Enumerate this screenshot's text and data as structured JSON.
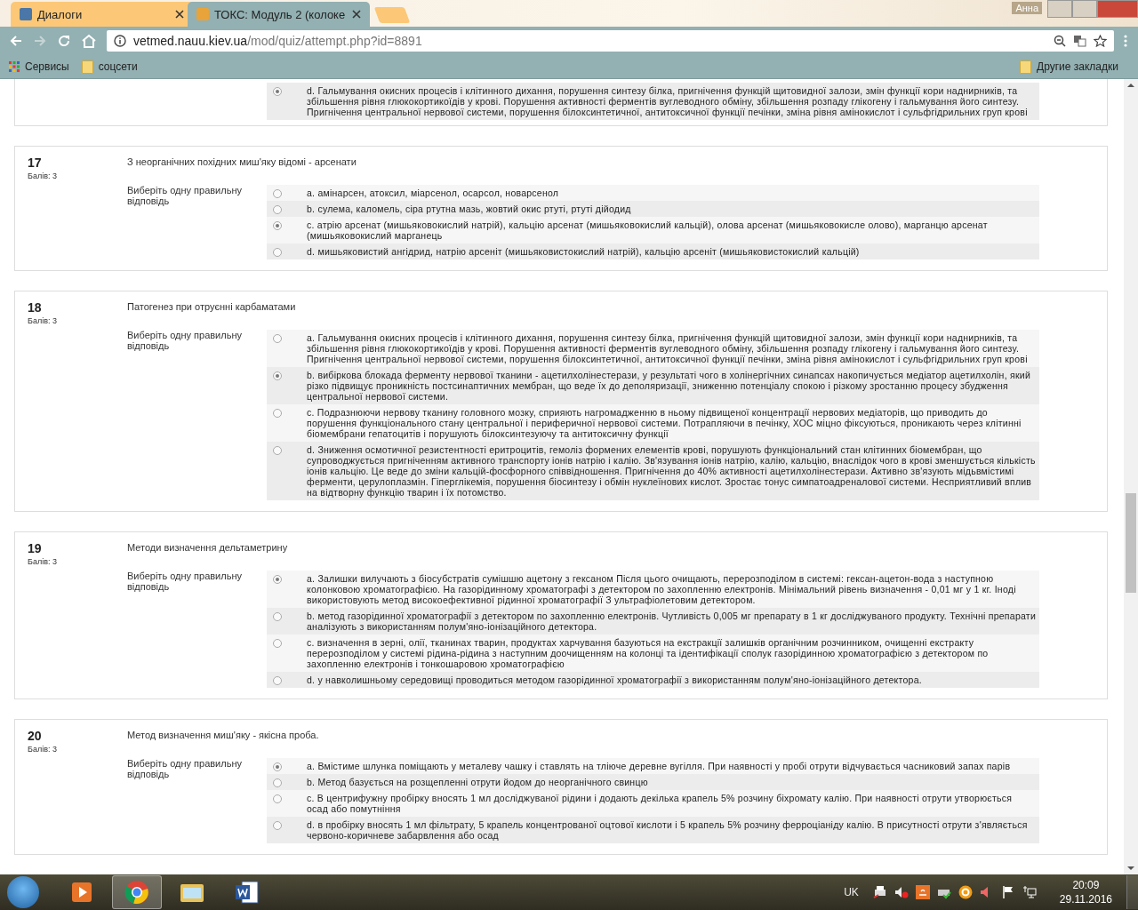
{
  "browser": {
    "tabs": [
      {
        "title": "Диалоги",
        "selected": false
      },
      {
        "title": "ТОКС: Модуль 2 (колоке",
        "selected": true
      }
    ],
    "profile": "Анна",
    "url_host": "vetmed.nauu.kiev.ua",
    "url_path": "/mod/quiz/attempt.php?id=8891",
    "bookmarks": [
      "Сервисы",
      "соцсети"
    ],
    "other_bookmarks": "Другие закладки"
  },
  "previous_question_tail": {
    "options": [
      {
        "letter": "d.",
        "text": "Гальмування окисних процесів і клітинного дихання, порушення синтезу білка, пригнічення функцій щитовидної залози, змін функції кори наднирників, та збільшення рівня глюкокортикоїдів у крові. Порушення активності ферментів вуглеводного обміну, збільшення розпаду глікогену і гальмування його синтезу. Пригнічення центральної нервової системи, порушення білоксинтетичної, антитоксичної функції печінки, зміна рівня амінокислот і сульфгідрильних груп крові",
        "selected": true
      }
    ]
  },
  "questions": [
    {
      "number": "17",
      "mark": "Балів: 3",
      "text": "З неорганічних похідних миш'яку відомі - арсенати",
      "prompt": "Виберіть одну правильну відповідь",
      "options": [
        {
          "letter": "a.",
          "text": "амінарсен, атоксил, міарсенол, осарсол, новарсенол",
          "selected": false
        },
        {
          "letter": "b.",
          "text": "сулема, каломель, сіра ртутна мазь, жовтий окис ртуті, ртуті дійодид",
          "selected": false
        },
        {
          "letter": "c.",
          "text": "атрію арсенат (мишьяковокислий натрій), кальцію арсенат (мишьяковокислий кальцій), олова арсенат (мишьяковокисле олово), марганцю арсенат (мишьяковокислий марганець",
          "selected": true
        },
        {
          "letter": "d.",
          "text": "мишьяковистий ангідрид, натрію арсеніт (мишьяковистокислий натрій), кальцію арсеніт (мишьяковистокислий кальцій)",
          "selected": false
        }
      ]
    },
    {
      "number": "18",
      "mark": "Балів: 3",
      "text": "Патогенез при отруєнні карбаматами",
      "prompt": "Виберіть одну правильну відповідь",
      "options": [
        {
          "letter": "a.",
          "text": "Гальмування окисних процесів і клітинного дихання, порушення синтезу білка, пригнічення функцій щитовидної залози, змін функції кори наднирників, та збільшення рівня глюкокортикоїдів у крові. Порушення активності ферментів вуглеводного обміну, збільшення розпаду глікогену і гальмування його синтезу. Пригнічення центральної нервової системи, порушення білоксинтетичної, антитоксичної функції печінки, зміна рівня амінокислот і сульфгідрильних груп крові",
          "selected": false
        },
        {
          "letter": "b.",
          "text": "вибіркова блокада ферменту нервової тканини - ацетилхолінестерази, у результаті чого в холінергічних синапсах накопичується медіатор ацетилхолін, який різко підвищує проникність постсинаптичних мембран, що веде їх до деполяризації, зниженню потенціалу спокою і різкому зростанню процесу збудження центральної нервової системи.",
          "selected": true
        },
        {
          "letter": "c.",
          "text": "Подразнюючи нервову тканину головного мозку, сприяють нагромадженню в ньому підвищеної концентрації нервових медіаторів, що приводить до порушення функціонального стану центральної і периферичної нервової системи. Потрапляючи в печінку, ХОС міцно фіксуються, проникають через клітинні біомембрани гепатоцитів і порушують білоксинтезуючу та антитоксичну функції",
          "selected": false
        },
        {
          "letter": "d.",
          "text": "Зниження осмотичної резистентності еритроцитів, гемоліз формених елементів крові, порушують функціональний стан клітинних біомембран, що супроводжується пригніченням активного транспорту іонів натрію і калію. Зв'язування іонів натрію, калію, кальцію, внаслідок чого в крові зменшується кількість іонів кальцію. Це веде до зміни кальцій-фосфорного співвідношення. Пригнічення до 40% активності ацетилхолінестерази. Активно зв'язують мідьвмістимі ферменти, церулоплазмін. Гіперглікемія, порушення біосинтезу і обмін нуклеїнових кислот. Зростає тонус симпатоадреналової системи. Несприятливий вплив на відтворну функцію тварин і їх потомство.",
          "selected": false
        }
      ]
    },
    {
      "number": "19",
      "mark": "Балів: 3",
      "text": "Методи визначення дельтаметрину",
      "prompt": "Виберіть одну правильну відповідь",
      "options": [
        {
          "letter": "a.",
          "text": "Залишки вилучають з біосубстратів сумішшю ацетону з гексаном Після цього очищають, перерозподілом в системі: гексан-ацетон-вода з наступною колонковою хроматографією. На газорідинному хроматографі з детектором по захопленню електронів. Мінімальний рівень визначення - 0,01 мг у 1 кг. Іноді використовують метод високоефективної рідинної хроматографії З ультрафіолетовим детектором.",
          "selected": true
        },
        {
          "letter": "b.",
          "text": "метод газорідинної хроматографії з детектором по захопленню електронів. Чутливість 0,005 мг препарату в 1 кг досліджуваного продукту. Технічні препарати аналізують з використанням полум'яно-іонізаційного детектора.",
          "selected": false
        },
        {
          "letter": "c.",
          "text": "визначення в зерні, олії, тканинах тварин, продуктах харчування базуються на екстракції залишків органічним розчинником, очищенні екстракту перерозподілом у системі рідина-рідина з наступним доочищенням на колонці та ідентифікації сполук газорідинною хроматографією з детектором по захопленню електронів і тонкошаровою хроматографією",
          "selected": false
        },
        {
          "letter": "d.",
          "text": "у навколишньому середовищі проводиться методом газорідинної хроматографії з використанням полум'яно-іонізаційного детектора.",
          "selected": false
        }
      ]
    },
    {
      "number": "20",
      "mark": "Балів: 3",
      "text": "Метод визначення миш'яку - якісна проба.",
      "prompt": "Виберіть одну правильну відповідь",
      "options": [
        {
          "letter": "a.",
          "text": "Вмістиме шлунка поміщають у металеву чашку і ставлять на тліюче деревне вугілля. При наявності у пробі отрути відчувається часниковий запах парів",
          "selected": true
        },
        {
          "letter": "b.",
          "text": "Метод базується на розщепленні отрути йодом до неорганічного свинцю",
          "selected": false
        },
        {
          "letter": "c.",
          "text": "В центрифужну пробірку вносять 1 мл досліджуваної рідини і додають декілька крапель 5% розчину біхромату калію. При наявності отрути утворюється осад або помутніння",
          "selected": false
        },
        {
          "letter": "d.",
          "text": "в пробірку вносять 1 мл фільтрату, 5 крапель концентрованої оцтової кислоти і 5 крапель 5% розчину ферроціаніду калію. В присутності отрути з'являється червоно-коричневе забарвлення або осад",
          "selected": false
        }
      ]
    }
  ],
  "taskbar": {
    "language": "UK",
    "time": "20:09",
    "date": "29.11.2016"
  }
}
